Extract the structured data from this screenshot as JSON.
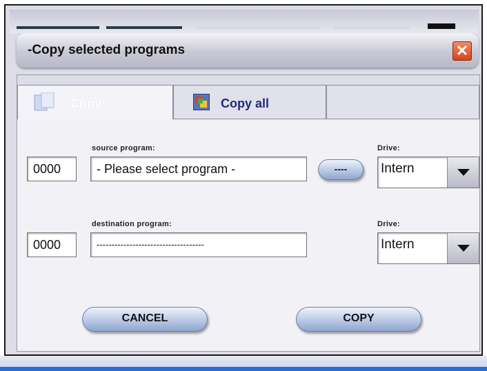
{
  "window": {
    "title": "-Copy selected programs",
    "close_glyph": "✕"
  },
  "tabs": [
    {
      "label": "Copy",
      "icon": "copy-pages-icon",
      "active": true
    },
    {
      "label": "Copy all",
      "icon": "copy-all-icon",
      "active": false
    }
  ],
  "source": {
    "number": "0000",
    "label": "source program:",
    "value": "- Please select program -",
    "browse_label": "----",
    "drive_label": "Drive:",
    "drive_value": "Intern"
  },
  "destination": {
    "number": "0000",
    "label": "destination program:",
    "value": "------------------------------------",
    "drive_label": "Drive:",
    "drive_value": "Intern"
  },
  "buttons": {
    "cancel": "CANCEL",
    "copy": "COPY"
  },
  "colors": {
    "tab_active_text": "#ffffff",
    "tab_inactive_text": "#1d2b7c",
    "close_button": "#e0572f",
    "bottom_bar": "#2d6bd6"
  }
}
